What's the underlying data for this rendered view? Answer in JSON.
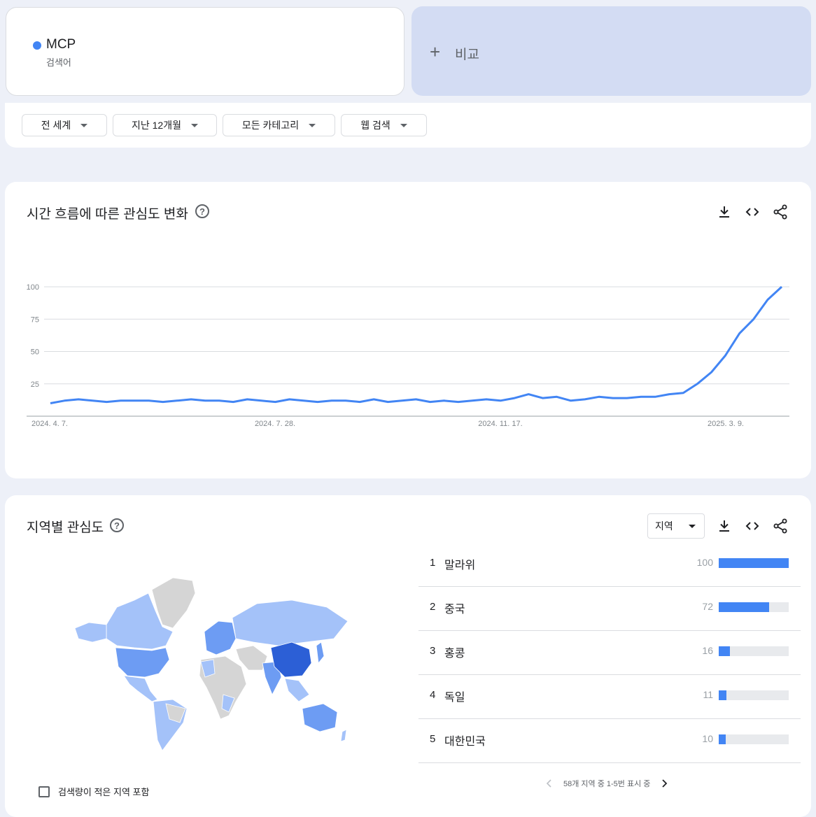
{
  "term": {
    "name": "MCP",
    "type": "검색어",
    "color": "#4285f4"
  },
  "compare": {
    "icon": "plus-icon",
    "label": "비교"
  },
  "filters": {
    "region": "전 세계",
    "period": "지난 12개월",
    "category": "모든 카테고리",
    "search_type": "웹 검색"
  },
  "time_section": {
    "title": "시간 흐름에 따른 관심도 변화",
    "tools": [
      "download-icon",
      "embed-icon",
      "share-icon"
    ]
  },
  "chart_data": {
    "type": "line",
    "title": "",
    "xlabel": "",
    "ylabel": "",
    "ylim": [
      0,
      100
    ],
    "yticks": [
      25,
      50,
      75,
      100
    ],
    "xtick_labels": [
      "2024. 4. 7.",
      "2024. 7. 28.",
      "2024. 11. 17.",
      "2025. 3. 9."
    ],
    "grid": true,
    "series": [
      {
        "name": "MCP",
        "color": "#4285f4",
        "values": [
          10,
          12,
          13,
          12,
          11,
          12,
          12,
          12,
          11,
          12,
          13,
          12,
          12,
          11,
          13,
          12,
          11,
          13,
          12,
          11,
          12,
          12,
          11,
          13,
          11,
          12,
          13,
          11,
          12,
          11,
          12,
          13,
          12,
          14,
          17,
          14,
          15,
          12,
          13,
          15,
          14,
          14,
          15,
          15,
          17,
          18,
          25,
          34,
          47,
          64,
          75,
          90,
          100
        ]
      }
    ]
  },
  "region_section": {
    "title": "지역별 관심도",
    "resolution": "지역",
    "tools": [
      "download-icon",
      "embed-icon",
      "share-icon"
    ],
    "colors": {
      "top": "#2c5fd6",
      "high": "#6d9cf3",
      "mid": "#a4c2f9",
      "none": "#d5d5d5"
    },
    "rows": [
      {
        "rank": "1",
        "name": "말라위",
        "value": 100
      },
      {
        "rank": "2",
        "name": "중국",
        "value": 72
      },
      {
        "rank": "3",
        "name": "홍콩",
        "value": 16
      },
      {
        "rank": "4",
        "name": "독일",
        "value": 11
      },
      {
        "rank": "5",
        "name": "대한민국",
        "value": 10
      }
    ],
    "pager": "58개 지역 중 1-5번 표시 중",
    "checkbox_label": "검색량이 적은 지역 포함"
  }
}
